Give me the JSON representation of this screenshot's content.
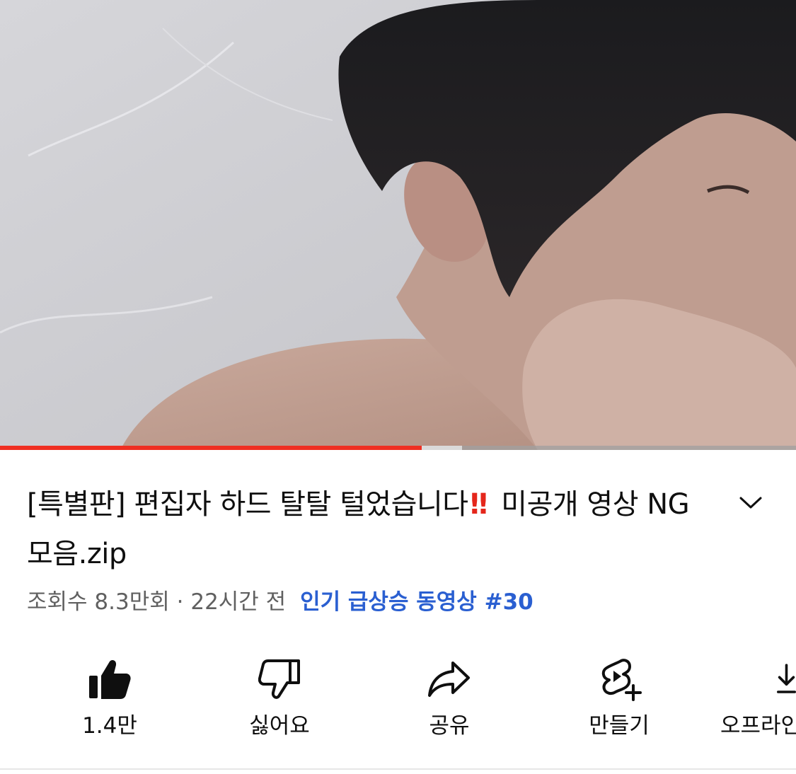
{
  "video": {
    "progress_played_percent": 53,
    "progress_buffered_percent": 58
  },
  "title": {
    "text_before": "[특별판] 편집자 하드 탈탈 털었습니다",
    "mark": "!!",
    "text_after": " 미공개 영상 NG 모음.zip"
  },
  "meta": {
    "views": "조회수 8.3만회",
    "separator": "·",
    "time": "22시간 전",
    "trending": "인기 급상승 동영상 #30"
  },
  "actions": {
    "like": {
      "label": "1.4만",
      "icon": "thumb-up-filled-icon"
    },
    "dislike": {
      "label": "싫어요",
      "icon": "thumb-down-outline-icon"
    },
    "share": {
      "label": "공유",
      "icon": "share-arrow-icon"
    },
    "remix": {
      "label": "만들기",
      "icon": "shorts-create-icon"
    },
    "download": {
      "label": "오프라인",
      "icon": "download-icon"
    }
  },
  "colors": {
    "accent_red": "#ef2f22",
    "link_blue": "#2a5fd1",
    "secondary_text": "#606060"
  }
}
